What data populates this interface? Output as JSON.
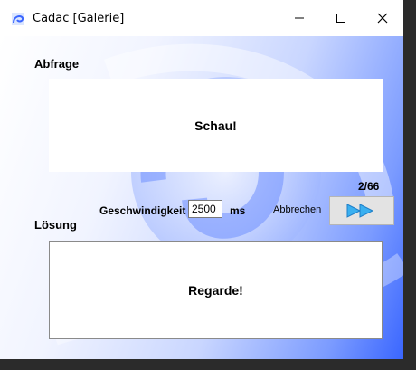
{
  "window": {
    "title": "Cadac [Galerie]"
  },
  "query": {
    "heading": "Abfrage",
    "text": "Schau!"
  },
  "controls": {
    "speed_label": "Geschwindigkeit",
    "speed_value": "2500",
    "speed_unit": "ms",
    "cancel_label": "Abbrechen",
    "counter": "2/66"
  },
  "answer": {
    "heading": "Lösung",
    "text": "Regarde!"
  },
  "icons": {
    "app": "app-swirl-icon",
    "minimize": "minimize-icon",
    "maximize": "maximize-icon",
    "close": "close-icon",
    "next": "fast-forward-icon"
  },
  "colors": {
    "accent": "#3a66ff"
  }
}
